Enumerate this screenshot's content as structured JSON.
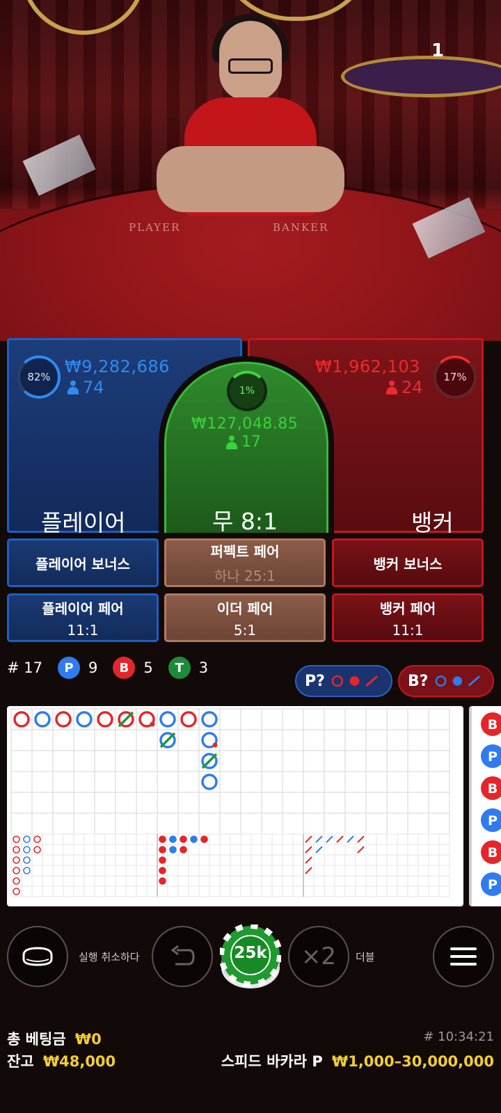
{
  "video": {
    "felt_player": "PLAYER",
    "felt_banker": "BANKER",
    "side_table_number": "1"
  },
  "player": {
    "percent": "82%",
    "amount": "₩9,282,686",
    "count": "74",
    "label": "플레이어",
    "color": "#2e8cf2"
  },
  "tie": {
    "percent": "1%",
    "amount": "₩127,048.85",
    "count": "17",
    "label": "무 8:1",
    "color": "#39d23a"
  },
  "banker": {
    "percent": "17%",
    "amount": "₩1,962,103",
    "count": "24",
    "label": "뱅커",
    "color": "#ee2a2f"
  },
  "side_bets": {
    "player_bonus": "플레이어 보너스",
    "perfect_pair": "퍼펙트 페어",
    "perfect_pair_odds": "하나 25:1",
    "banker_bonus": "뱅커 보너스",
    "player_pair": "플레이어 페어",
    "player_pair_odds": "11:1",
    "either_pair": "이더 페어",
    "either_pair_odds": "5:1",
    "banker_pair": "뱅커 페어",
    "banker_pair_odds": "11:1"
  },
  "stats": {
    "round_label": "# 17",
    "p_letter": "P",
    "p_count": "9",
    "b_letter": "B",
    "b_count": "5",
    "t_letter": "T",
    "t_count": "3",
    "player_predict": "P?",
    "banker_predict": "B?"
  },
  "roadmap": {
    "big_road_cols": [
      [
        "R"
      ],
      [
        "B"
      ],
      [
        "R"
      ],
      [
        "B"
      ],
      [
        "R"
      ],
      [
        "Rt"
      ],
      [
        "Rp"
      ],
      [
        "B",
        "Bt"
      ],
      [
        "R"
      ],
      [
        "B",
        "Bp",
        "Bt",
        "B"
      ]
    ],
    "side_road": [
      "B",
      "P",
      "B",
      "P",
      "B",
      "P"
    ]
  },
  "controls": {
    "undo_label": "실행 취소하다",
    "chip_value": "25k",
    "double_symbol": "×2",
    "double_label": "더블"
  },
  "footer": {
    "total_bet_label": "총 베팅금",
    "total_bet_value": "₩0",
    "balance_label": "잔고",
    "balance_value": "₩48,000",
    "round_id": "# 10:34:21",
    "table_name": "스피드 바카라 P",
    "limits": "₩1,000–30,000,000"
  }
}
